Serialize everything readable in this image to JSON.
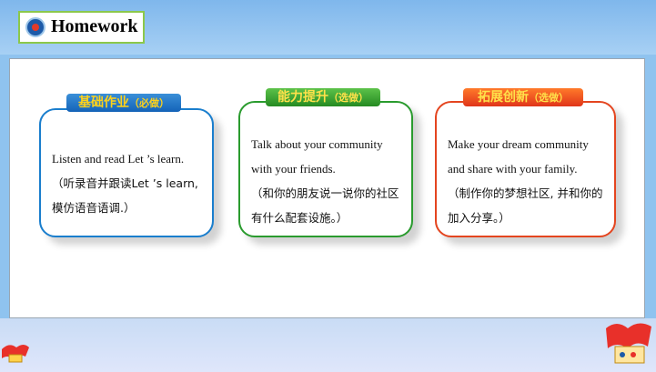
{
  "title": {
    "text": "Homework"
  },
  "cards": [
    {
      "tag": "基础作业",
      "tag_sub": "（必做）",
      "en": "Listen and read Let ’s learn.",
      "zh": "（听录音并跟读Let ’s learn,模仿语音语调.）"
    },
    {
      "tag": "能力提升",
      "tag_sub": "（选做）",
      "en": "Talk about your community with your friends.",
      "zh": "（和你的朋友说一说你的社区有什么配套设施。）"
    },
    {
      "tag": "拓展创新",
      "tag_sub": "（选做）",
      "en": "Make your dream community and share with your family.",
      "zh": "（制作你的梦想社区, 并和你的加入分享。）"
    }
  ],
  "colors": {
    "card1": "#1a7ecd",
    "card2": "#2a9b2e",
    "card3": "#e4451f",
    "title_border": "#8cc84b"
  },
  "icons": [
    "school-logo-icon",
    "decorative-flag-left-icon",
    "decorative-flag-right-icon"
  ]
}
